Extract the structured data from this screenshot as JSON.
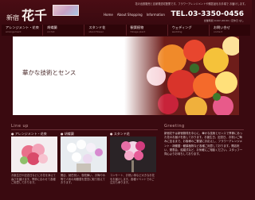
{
  "header": {
    "logo_small": "新宿",
    "logo_big": "花千",
    "tagline": "花の出張販売と自家発送宅配業です。フラワーアレンジメントや贈答品をお手頃で お届けします。",
    "topnav": [
      "Home",
      "About Shopping",
      "Information"
    ],
    "phone": "TEL.03-3350-0456",
    "phone_sub": "営業時間 9:00〜20:00 / 定休日 なし"
  },
  "mainnav": [
    {
      "label": "アレンジメント・花束",
      "sub": "arrangement"
    },
    {
      "label": "胡蝶蘭",
      "sub": "orchid"
    },
    {
      "label": "スタンド花",
      "sub": "stand flower"
    },
    {
      "label": "観葉植物",
      "sub": "foliage plant"
    },
    {
      "label": "ウェディング",
      "sub": "wedding"
    },
    {
      "label": "お問い合せ",
      "sub": "contact"
    }
  ],
  "hero": {
    "tagline": "華かな技術とセンス"
  },
  "lineup": {
    "title": "Line up",
    "cards": [
      {
        "label": "● アレンジメント・花束",
        "desc": "お誕生日や記念日などにお花を添えて喜びを届けます。季節に合わせて各種ご用意しております。"
      },
      {
        "label": "● 胡蝶蘭",
        "desc": "開店、就任祝い、御見舞い、お悔やみ等で人気の胡蝶蘭を豊富に取り揃えております。"
      },
      {
        "label": "● スタンド花",
        "desc": "コンサート、お祝い事など大きなお花をお届けします。各種イベントでのご注文も承ります。"
      }
    ]
  },
  "greeting": {
    "title": "Greeting",
    "text": "新宿花千は新宿御苑を中心に、華かな技術とセンスで季節にあった花のお届けを致しております。お誕生日、記念日、お祝いご悔みに至るまで、お客様のご要望にお応えし、フラワーアレンジメント・胡蝶蘭・観葉植物など各種ご用意しております。開店祝い、発表会、結婚式など、お気軽にご相談ください。スタッフ一同心よりお待ちしております。"
  }
}
